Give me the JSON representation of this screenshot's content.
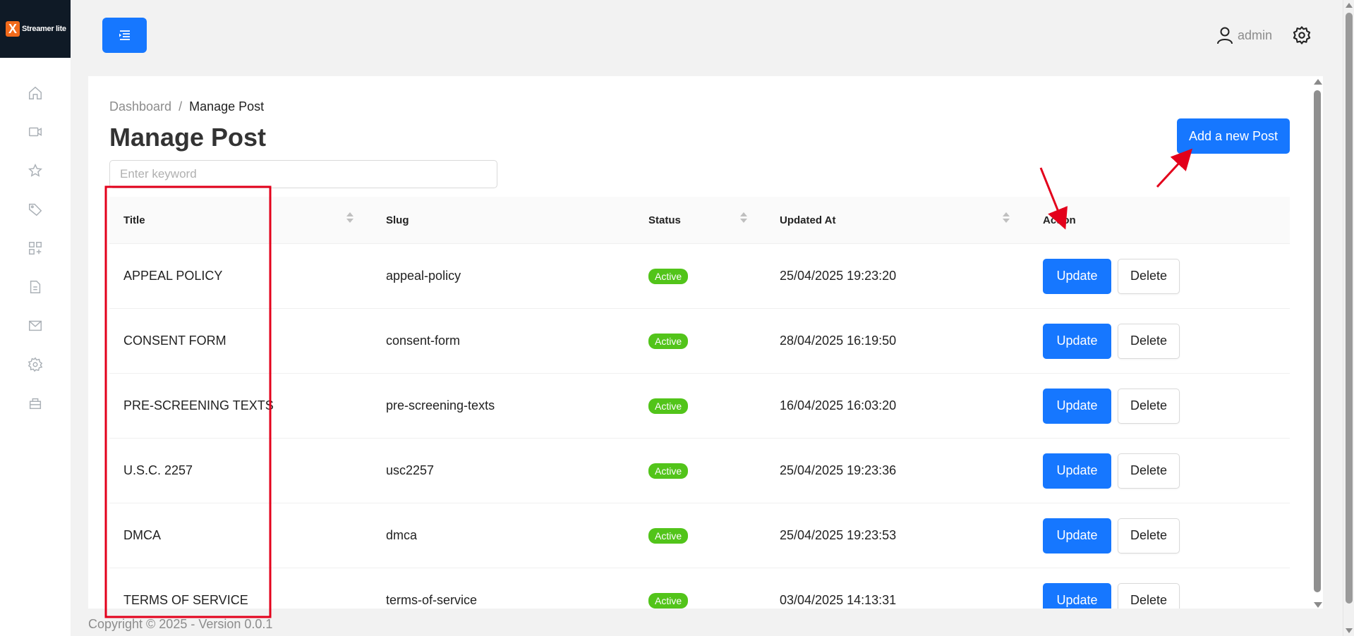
{
  "app": {
    "logo_mark": "X",
    "logo_text": "Streamer lite"
  },
  "header": {
    "user_name": "admin"
  },
  "breadcrumb": {
    "home": "Dashboard",
    "separator": "/",
    "current": "Manage Post"
  },
  "page": {
    "title": "Manage Post",
    "add_button": "Add a new Post"
  },
  "search": {
    "placeholder": "Enter keyword",
    "value": ""
  },
  "table": {
    "columns": [
      "Title",
      "Slug",
      "Status",
      "Updated At",
      "Action"
    ],
    "rows": [
      {
        "title": "APPEAL POLICY",
        "slug": "appeal-policy",
        "status": "Active",
        "updated_at": "25/04/2025 19:23:20"
      },
      {
        "title": "CONSENT FORM",
        "slug": "consent-form",
        "status": "Active",
        "updated_at": "28/04/2025 16:19:50"
      },
      {
        "title": "PRE-SCREENING TEXTS",
        "slug": "pre-screening-texts",
        "status": "Active",
        "updated_at": "16/04/2025 16:03:20"
      },
      {
        "title": "U.S.C. 2257",
        "slug": "usc2257",
        "status": "Active",
        "updated_at": "25/04/2025 19:23:36"
      },
      {
        "title": "DMCA",
        "slug": "dmca",
        "status": "Active",
        "updated_at": "25/04/2025 19:23:53"
      },
      {
        "title": "TERMS OF SERVICE",
        "slug": "terms-of-service",
        "status": "Active",
        "updated_at": "03/04/2025 14:13:31"
      }
    ],
    "update_label": "Update",
    "delete_label": "Delete"
  },
  "footer": {
    "text": "Copyright © 2025 - Version 0.0.1"
  },
  "sidebar": {
    "icons": [
      "home-icon",
      "video-icon",
      "star-icon",
      "tag-icon",
      "widgets-icon",
      "file-icon",
      "mail-icon",
      "settings-icon",
      "store-icon"
    ]
  },
  "colors": {
    "primary": "#1677ff",
    "active_badge": "#52c41a",
    "annotation": "#e3001b",
    "logo_bg": "#0f1a26",
    "logo_mark": "#f26a1b"
  }
}
